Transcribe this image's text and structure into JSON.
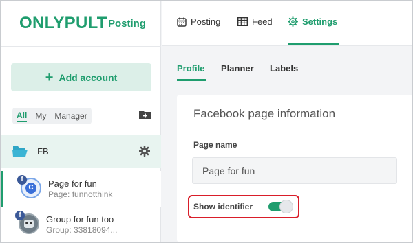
{
  "brand": {
    "name": "ONLYPULT",
    "sub": "Posting"
  },
  "sidebar": {
    "add_account": "Add account",
    "filters": [
      "All",
      "My",
      "Manager"
    ],
    "group": {
      "label": "FB"
    },
    "accounts": [
      {
        "name": "Page for fun",
        "sub": "Page: funnotthink",
        "avatar_letter": "C"
      },
      {
        "name": "Group for fun too",
        "sub": "Group: 33818094..."
      }
    ]
  },
  "topnav": {
    "items": [
      "Posting",
      "Feed",
      "Settings"
    ]
  },
  "subtabs": [
    "Profile",
    "Planner",
    "Labels"
  ],
  "card": {
    "title": "Facebook page information",
    "page_name_label": "Page name",
    "page_name_value": "Page for fun",
    "show_identifier_label": "Show identifier",
    "show_identifier_on": true
  },
  "colors": {
    "accent": "#1f9d6e",
    "highlight": "#d91e2a",
    "facebook": "#3b5998"
  }
}
